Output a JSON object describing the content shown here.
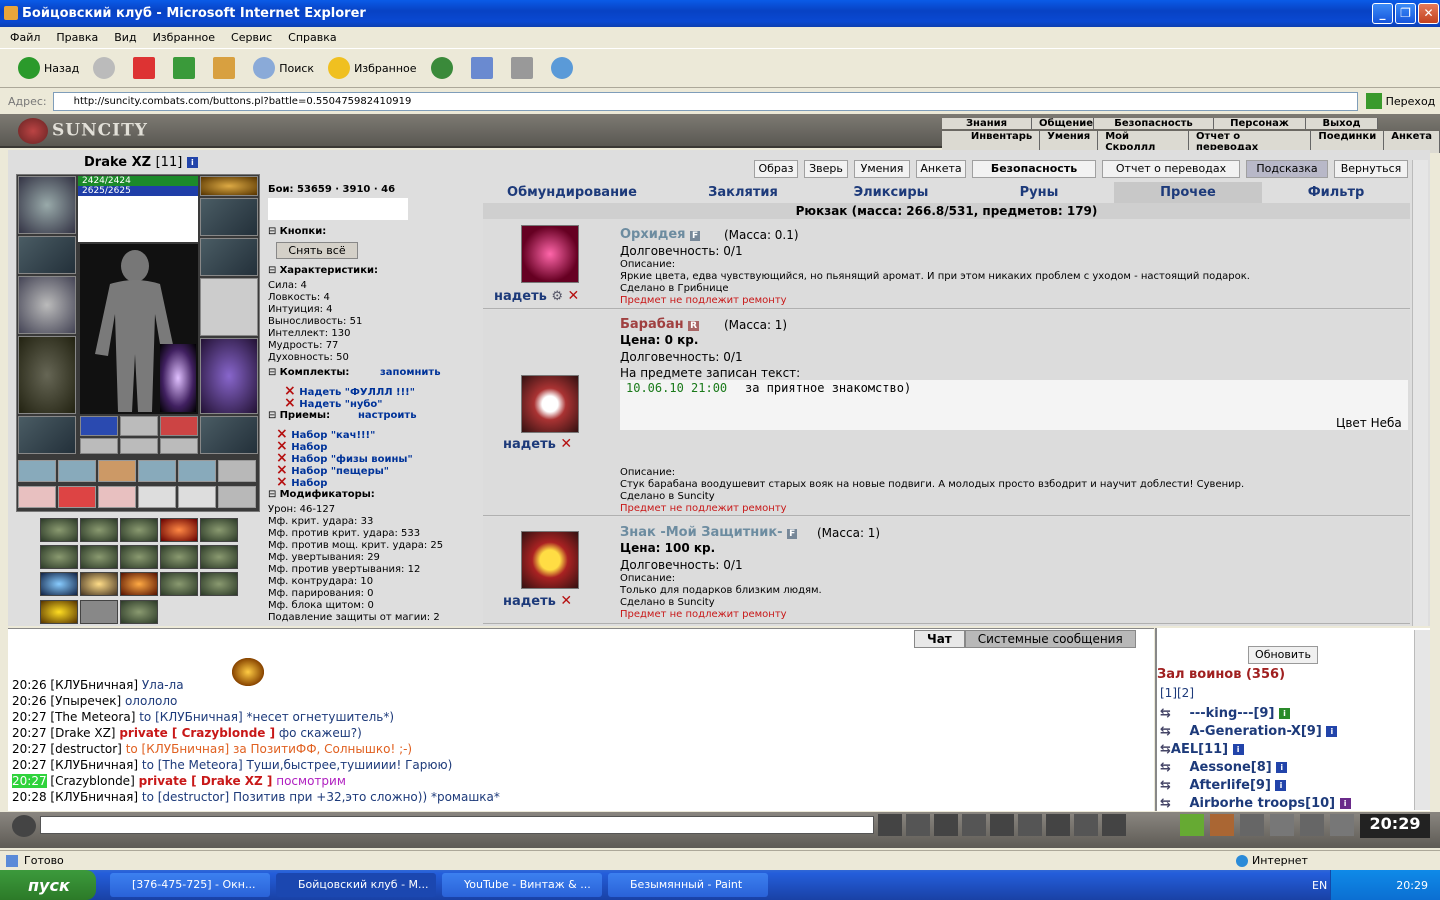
{
  "window": {
    "title": "Бойцовский клуб - Microsoft Internet Explorer"
  },
  "menu": [
    "Файл",
    "Правка",
    "Вид",
    "Избранное",
    "Сервис",
    "Справка"
  ],
  "toolbar": {
    "back": "Назад",
    "search": "Поиск",
    "favorites": "Избранное"
  },
  "address": {
    "label": "Адрес:",
    "url": "http://suncity.combats.com/buttons.pl?battle=0.550475982410919",
    "go": "Переход"
  },
  "game": {
    "logo": "SUNCITY",
    "topnav1": [
      "Знания",
      "Общение",
      "Безопасность",
      "Персонаж",
      "Выход"
    ],
    "topnav2": [
      "Инвентарь",
      "Умения",
      "Мой Скроллл",
      "Отчет о переводах",
      "Поединки",
      "Анкета"
    ],
    "char_name": "Drake XZ",
    "char_level": "[11]",
    "hp": "2424/2424",
    "mp": "2625/2625",
    "fights_label": "Бои:",
    "fights_vals": [
      "53659",
      "3910",
      "46"
    ],
    "sections": {
      "buttons": "Кнопки:",
      "undress": "Снять всё",
      "chars": "Характеристики:",
      "sets": "Комплекты:",
      "remember": "запомнить",
      "tricks": "Приемы:",
      "tune": "настроить",
      "mods": "Модификаторы:"
    },
    "stats": [
      "Сила: 4",
      "Ловкость: 4",
      "Интуиция: 4",
      "Выносливость: 51",
      "Интеллект: 130",
      "Мудрость: 77",
      "Духовность: 50"
    ],
    "sets": [
      "Надеть \"ФУЛЛЛ !!!\"",
      "Надеть \"нубо\""
    ],
    "trickset": [
      "Набор \"кач!!!\"",
      "Набор",
      "Набор \"физы воины\"",
      "Набор \"пещеры\"",
      "Набор"
    ],
    "mods": [
      "Урон: 46-127",
      "Мф. крит. удара: 33",
      "Мф. против крит. удара: 533",
      "Мф. против мощ. крит. удара: 25",
      "Мф. увертывания: 29",
      "Мф. против увертывания: 12",
      "Мф. контрудара: 10",
      "Мф. парирования: 0",
      "Мф. блока щитом: 0",
      "Подавление защиты от магии: 2"
    ],
    "right_buttons": [
      "Образ",
      "Зверь",
      "Умения",
      "Анкета",
      "Безопасность",
      "Отчет о переводах",
      "Подсказка",
      "Вернуться"
    ],
    "tabs": [
      "Обмундирование",
      "Заклятия",
      "Эликсиры",
      "Руны",
      "Прочее",
      "Фильтр"
    ],
    "backpack": "Рюкзак (масса: 266.8/531, предметов: 179)",
    "items": [
      {
        "name": "Орхидея",
        "badge": "F",
        "mass": "(Масса: 0.1)",
        "lines": [
          "Долговечность: 0/1"
        ],
        "desc_label": "Описание:",
        "desc": "Яркие цвета, едва чувствующийся, но пьянящий аромат. И при этом никаких проблем с уходом - настоящий подарок.",
        "made": "Сделано в Грибнице",
        "norepair": "Предмет не подлежит ремонту",
        "wear": "надеть"
      },
      {
        "name": "Барабан",
        "badge": "R",
        "mass": "(Масса: 1)",
        "price": "Цена: 0 кр.",
        "lines": [
          "Долговечность: 0/1",
          "На предмете записан текст:"
        ],
        "inscription_date": "10.06.10 21:00",
        "inscription": "за приятное знакомство)",
        "signature": "Цвет Неба",
        "desc_label": "Описание:",
        "desc": "Стук барабана воодушевит старых вояк на новые подвиги. А молодых просто взбодрит и научит доблести! Сувенир.",
        "made": "Сделано в Suncity",
        "norepair": "Предмет не подлежит ремонту",
        "wear": "надеть"
      },
      {
        "name": "Знак -Мой Защитник-",
        "badge": "F",
        "mass": "(Масса: 1)",
        "price": "Цена: 100 кр.",
        "lines": [
          "Долговечность: 0/1"
        ],
        "desc_label": "Описание:",
        "desc": "Только для подарков близким людям.",
        "made": "Сделано в Suncity",
        "norepair": "Предмет не подлежит ремонту",
        "wear": "надеть"
      }
    ]
  },
  "chat": {
    "tabs": [
      "Чат",
      "Системные сообщения"
    ],
    "lines": [
      {
        "time": "20:26",
        "who": "[КЛУБничная]",
        "text": "Ула-ла"
      },
      {
        "time": "20:26",
        "who": "[Упыречек]",
        "text": "олололо"
      },
      {
        "time": "20:27",
        "who": "[The Meteora]",
        "to": "to [КЛУБничная]",
        "text": "*несет огнетушитель*)"
      },
      {
        "time": "20:27",
        "who": "[Drake XZ]",
        "priv": "private [ Crazyblonde ]",
        "text": "фо скажеш?)"
      },
      {
        "time": "20:27",
        "who": "[destructor]",
        "to": "to [КЛУБничная]",
        "text": "за ПозитиФФ, Солнышко! ;-)"
      },
      {
        "time": "20:27",
        "who": "[КЛУБничная]",
        "to": "to [The Meteora]",
        "text": "Туши,быстрее,тушииии! Гарюю)"
      },
      {
        "time": "20:27",
        "who": "[Crazyblonde]",
        "priv": "private [ Drake XZ ]",
        "text": "посмотрим"
      },
      {
        "time": "20:28",
        "who": "[КЛУБничная]",
        "to": "to [destructor]",
        "text": "Позитив при +32,это сложно)) *ромашка*"
      }
    ]
  },
  "online": {
    "refresh": "Обновить",
    "title": "Зал воинов (356)",
    "pages": "[1][2]",
    "users": [
      "---king---[9]",
      "A-Generation-X[9]",
      "AEL[11]",
      "Aessone[8]",
      "Afterlife[9]",
      "Airborhe troops[10]"
    ]
  },
  "clock": "20:29",
  "status": {
    "ready": "Готово",
    "zone": "Интернет"
  },
  "taskbar": {
    "start": "пуск",
    "tasks": [
      "[376-475-725] - Окн...",
      "Бойцовский клуб - M...",
      "YouTube - Винтаж & ...",
      "Безымянный - Paint"
    ],
    "lang": "EN",
    "time": "20:29"
  },
  "colors": {
    "titlebar": "#0a5be8",
    "hp": "#1c8a2a",
    "mp": "#1f3ea8",
    "private": "#c81818",
    "link": "#1d3a7a"
  }
}
